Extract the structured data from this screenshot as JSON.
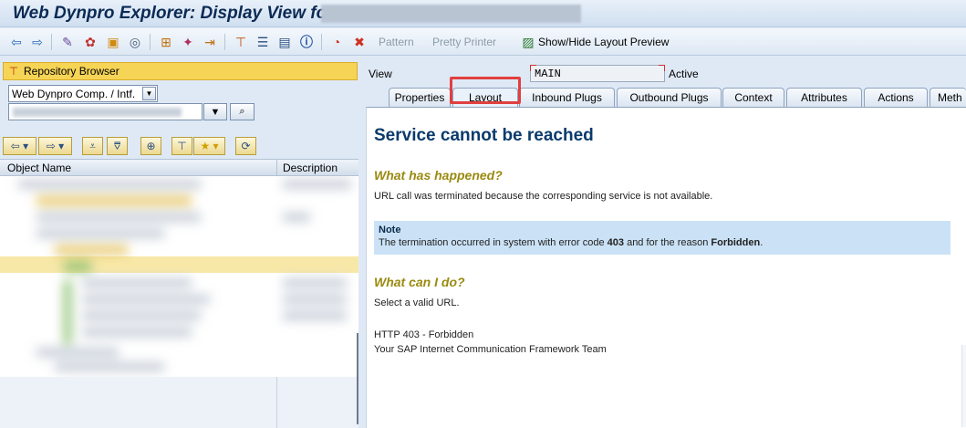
{
  "window": {
    "title": "Web Dynpro Explorer: Display View for"
  },
  "toolbar": {
    "icons": [
      "back-arrow-icon",
      "forward-arrow-icon",
      "other-object-icon",
      "display-change-icon",
      "activate-icon",
      "where-used-icon",
      "object-list-icon",
      "navigate-icon",
      "test-icon",
      "hierarchy-icon",
      "stack-icon",
      "info-icon",
      "pie-icon",
      "delete-icon"
    ],
    "pattern_label": "Pattern",
    "pretty_printer_label": "Pretty Printer",
    "layout_preview_label": "Show/Hide Layout Preview"
  },
  "repository": {
    "header": "Repository Browser",
    "object_type": "Web Dynpro Comp. / Intf.",
    "columns": {
      "name": "Object Name",
      "description": "Description"
    }
  },
  "view": {
    "label": "View",
    "name": "MAIN",
    "status": "Active"
  },
  "tabs": [
    {
      "label": "Properties"
    },
    {
      "label": "Layout"
    },
    {
      "label": "Inbound Plugs"
    },
    {
      "label": "Outbound Plugs"
    },
    {
      "label": "Context"
    },
    {
      "label": "Attributes"
    },
    {
      "label": "Actions"
    },
    {
      "label": "Meth"
    }
  ],
  "active_tab": "Layout",
  "error_page": {
    "title": "Service cannot be reached",
    "happened_heading": "What has happened?",
    "happened_text": "URL call was terminated because the corresponding service is not available.",
    "note_title": "Note",
    "note_text_1": "The termination occurred in system with error code ",
    "note_code": "403",
    "note_text_2": " and for the reason ",
    "note_reason": "Forbidden",
    "note_text_3": ".",
    "todo_heading": "What can I do?",
    "todo_text": "Select a valid URL.",
    "status_line": "HTTP 403 - Forbidden",
    "team_line": "Your SAP Internet Communication Framework Team"
  }
}
